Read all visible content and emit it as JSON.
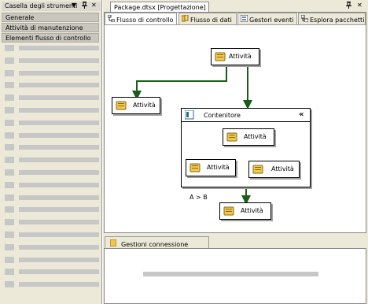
{
  "toolbox": {
    "title": "Casella degli strumenti",
    "controls": {
      "dropdown": "▼",
      "pin": "📌",
      "close": "✕"
    },
    "sections": [
      "Generale",
      "Attività di manutenzione",
      "Elementi flusso di controllo"
    ],
    "rows": 20
  },
  "document": {
    "tab_title": "Package.dtsx [Progettazione]",
    "controls": {
      "pin": "📌",
      "close": "✕"
    },
    "tabs": [
      "Flusso di controllo",
      "Flusso di dati",
      "Gestori eventi",
      "Esplora pacchetti"
    ]
  },
  "canvas": {
    "task_top": "Attività",
    "task_left": "Attività",
    "container_title": "Contenitore",
    "container_collapse": "«",
    "task_inner_top": "Attività",
    "task_inner_left": "Attività",
    "task_inner_right": "Attività",
    "constraint_label": "A > B",
    "task_bottom": "Attività"
  },
  "connections": {
    "tab_label": "Gestioni connessione"
  },
  "colors": {
    "arrow_green": "#1a5c1a",
    "arrow_red": "#8b1a1a",
    "panel_bg": "#ece9d8",
    "placeholder_gray": "#c7c7c7"
  }
}
